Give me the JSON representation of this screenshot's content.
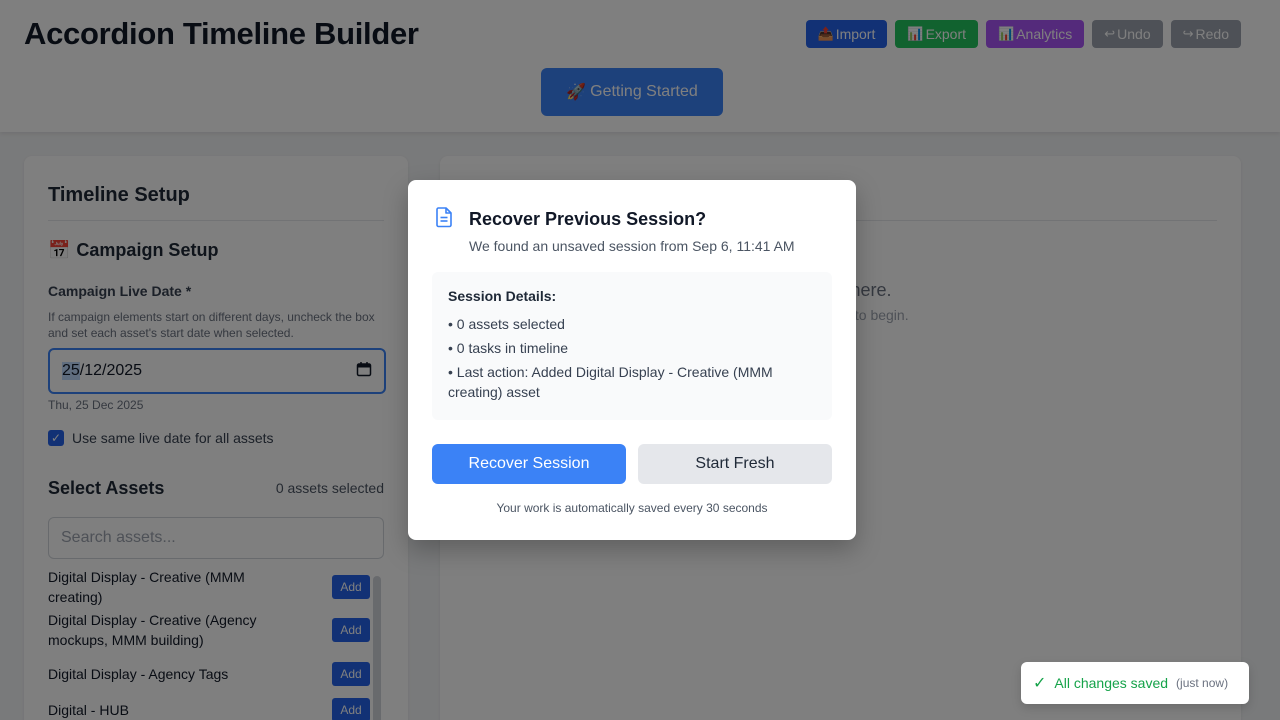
{
  "header": {
    "title": "Accordion Timeline Builder",
    "toolbar": [
      {
        "label": "Import",
        "icon": "📤"
      },
      {
        "label": "Export",
        "icon": "📊"
      },
      {
        "label": "Analytics",
        "icon": "📊"
      },
      {
        "label": "Undo",
        "icon": "↩"
      },
      {
        "label": "Redo",
        "icon": "↪"
      }
    ],
    "getting_started": {
      "label": "Getting Started",
      "icon": "🚀"
    }
  },
  "setup": {
    "title": "Timeline Setup",
    "section_title": "Campaign Setup",
    "section_icon": "📅",
    "date_label": "Campaign Live Date *",
    "helper": "If campaign elements start on different days, uncheck the box and set each asset's start date when selected.",
    "date_day": "25",
    "date_rest": "/12/2025",
    "date_readable": "Thu, 25 Dec 2025",
    "checkbox_label": "Use same live date for all assets",
    "checkbox_checked": true,
    "assets_title": "Select Assets",
    "assets_count": "0 assets selected",
    "search_placeholder": "Search assets...",
    "add_label": "Add",
    "assets": [
      "Digital Display - Creative (MMM creating)",
      "Digital Display - Creative (Agency mockups, MMM building)",
      "Digital Display - Agency Tags",
      "Digital - HUB"
    ]
  },
  "timeline": {
    "empty_main": "appear here.",
    "empty_sub": "some assets to begin."
  },
  "modal": {
    "title": "Recover Previous Session?",
    "subtitle": "We found an unsaved session from Sep 6, 11:41 AM",
    "details_title": "Session Details:",
    "details": [
      "• 0 assets selected",
      "• 0 tasks in timeline",
      "• Last action: Added Digital Display - Creative (MMM creating) asset"
    ],
    "recover_label": "Recover Session",
    "fresh_label": "Start Fresh",
    "footer": "Your work is automatically saved every 30 seconds"
  },
  "toast": {
    "check": "✓",
    "text": "All changes saved",
    "time": "(just now)"
  }
}
